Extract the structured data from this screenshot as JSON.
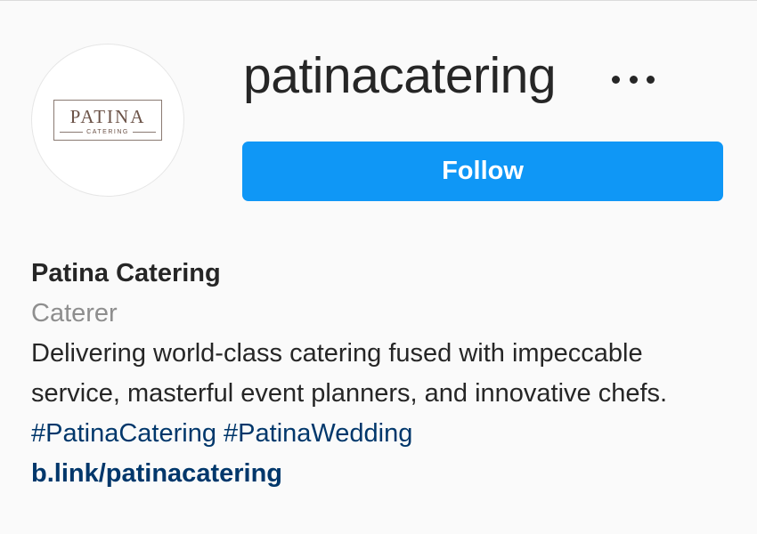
{
  "profile": {
    "username": "patinacatering",
    "avatar": {
      "logo_main": "PATINA",
      "logo_sub": "CATERING"
    },
    "more_icon": "ellipsis-icon",
    "follow_label": "Follow",
    "full_name": "Patina Catering",
    "category": "Caterer",
    "bio_text": "Delivering world-class catering fused with impeccable service, masterful event planners, and innovative chefs.",
    "hashtags": [
      "#PatinaCatering",
      "#PatinaWedding"
    ],
    "link": "b.link/patinacatering"
  },
  "colors": {
    "background": "#fafafa",
    "follow_button": "#0f97f6",
    "link": "#00376b",
    "secondary_text": "#8e8e8e",
    "logo": "#6b5247"
  }
}
